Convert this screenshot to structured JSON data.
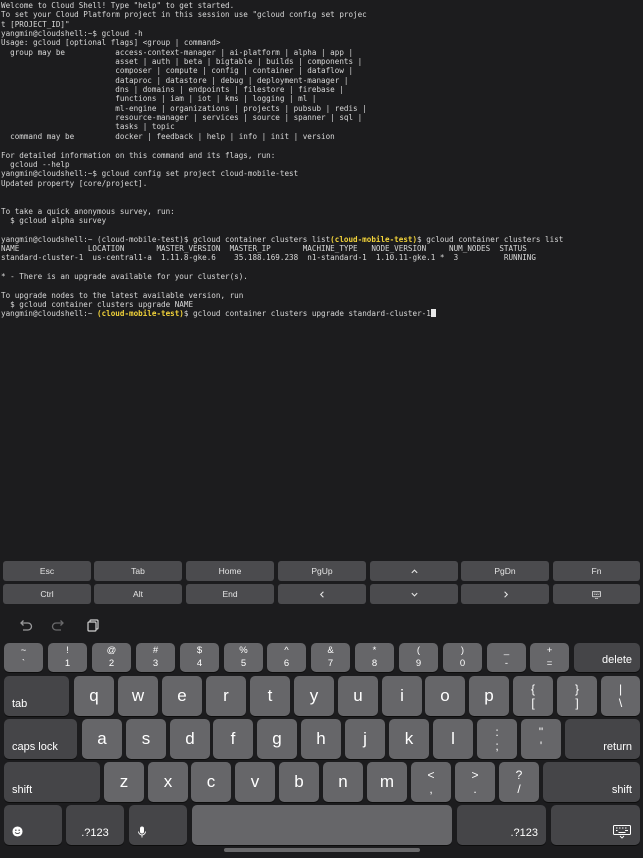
{
  "terminal": {
    "lines": [
      "Welcome to Cloud Shell! Type \"help\" to get started.",
      "To set your Cloud Platform project in this session use \"gcloud config set projec",
      "t [PROJECT_ID]\"",
      "yangmin@cloudshell:~$ gcloud -h",
      "Usage: gcloud [optional flags] <group | command>",
      "  group may be           access-context-manager | ai-platform | alpha | app |",
      "                         asset | auth | beta | bigtable | builds | components |",
      "                         composer | compute | config | container | dataflow |",
      "                         dataproc | datastore | debug | deployment-manager |",
      "                         dns | domains | endpoints | filestore | firebase |",
      "                         functions | iam | iot | kms | logging | ml |",
      "                         ml-engine | organizations | projects | pubsub | redis |",
      "                         resource-manager | services | source | spanner | sql |",
      "                         tasks | topic",
      "  command may be         docker | feedback | help | info | init | version",
      "",
      "For detailed information on this command and its flags, run:",
      "  gcloud --help",
      "yangmin@cloudshell:~$ gcloud config set project cloud-mobile-test",
      "Updated property [core/project].",
      "",
      "",
      "To take a quick anonymous survey, run:",
      "  $ gcloud alpha survey",
      "",
      "yangmin@cloudshell:~ (cloud-mobile-test)$ gcloud container clusters list",
      "NAME               LOCATION       MASTER_VERSION  MASTER_IP       MACHINE_TYPE   NODE_VERSION     NUM_NODES  STATUS",
      "standard-cluster-1  us-central1-a  1.11.8-gke.6    35.188.169.238  n1-standard-1  1.10.11-gke.1 *  3          RUNNING",
      "",
      "* - There is an upgrade available for your cluster(s).",
      "",
      "To upgrade nodes to the latest available version, run",
      "  $ gcloud container clusters upgrade NAME"
    ],
    "prompt_user": "yangmin@cloudshell:~ ",
    "prompt_project": "(cloud-mobile-test)",
    "prompt_suffix": "$ ",
    "current_command": "gcloud container clusters upgrade standard-cluster-1"
  },
  "extra_keys": {
    "row1": [
      "Esc",
      "Tab",
      "Home",
      "PgUp",
      "up-arrow-icon",
      "PgDn",
      "Fn"
    ],
    "row2": [
      "Ctrl",
      "Alt",
      "End",
      "left-arrow-icon",
      "down-arrow-icon",
      "right-arrow-icon",
      "keyboard-icon"
    ]
  },
  "keyboard": {
    "row_numbers": [
      {
        "top": "~",
        "bot": "`"
      },
      {
        "top": "!",
        "bot": "1"
      },
      {
        "top": "@",
        "bot": "2"
      },
      {
        "top": "#",
        "bot": "3"
      },
      {
        "top": "$",
        "bot": "4"
      },
      {
        "top": "%",
        "bot": "5"
      },
      {
        "top": "^",
        "bot": "6"
      },
      {
        "top": "&",
        "bot": "7"
      },
      {
        "top": "*",
        "bot": "8"
      },
      {
        "top": "(",
        "bot": "9"
      },
      {
        "top": ")",
        "bot": "0"
      },
      {
        "top": "_",
        "bot": "-"
      },
      {
        "top": "+",
        "bot": "="
      }
    ],
    "delete": "delete",
    "tab": "tab",
    "row_q": [
      "q",
      "w",
      "e",
      "r",
      "t",
      "y",
      "u",
      "i",
      "o",
      "p"
    ],
    "brace": {
      "top": "{",
      "bot": "["
    },
    "close_brace": {
      "top": "}",
      "bot": "]"
    },
    "pipe": {
      "top": "|",
      "bot": "\\"
    },
    "caps_lock": "caps lock",
    "row_a": [
      "a",
      "s",
      "d",
      "f",
      "g",
      "h",
      "j",
      "k",
      "l"
    ],
    "colon": {
      "top": ":",
      "bot": ";"
    },
    "quote": {
      "top": "\"",
      "bot": "'"
    },
    "return": "return",
    "shift": "shift",
    "row_z": [
      "z",
      "x",
      "c",
      "v",
      "b",
      "n",
      "m"
    ],
    "lt": {
      "top": "<",
      "bot": ","
    },
    "gt": {
      "top": ">",
      "bot": "."
    },
    "question": {
      "top": "?",
      "bot": "/"
    },
    "numbers_label": ".?123"
  }
}
